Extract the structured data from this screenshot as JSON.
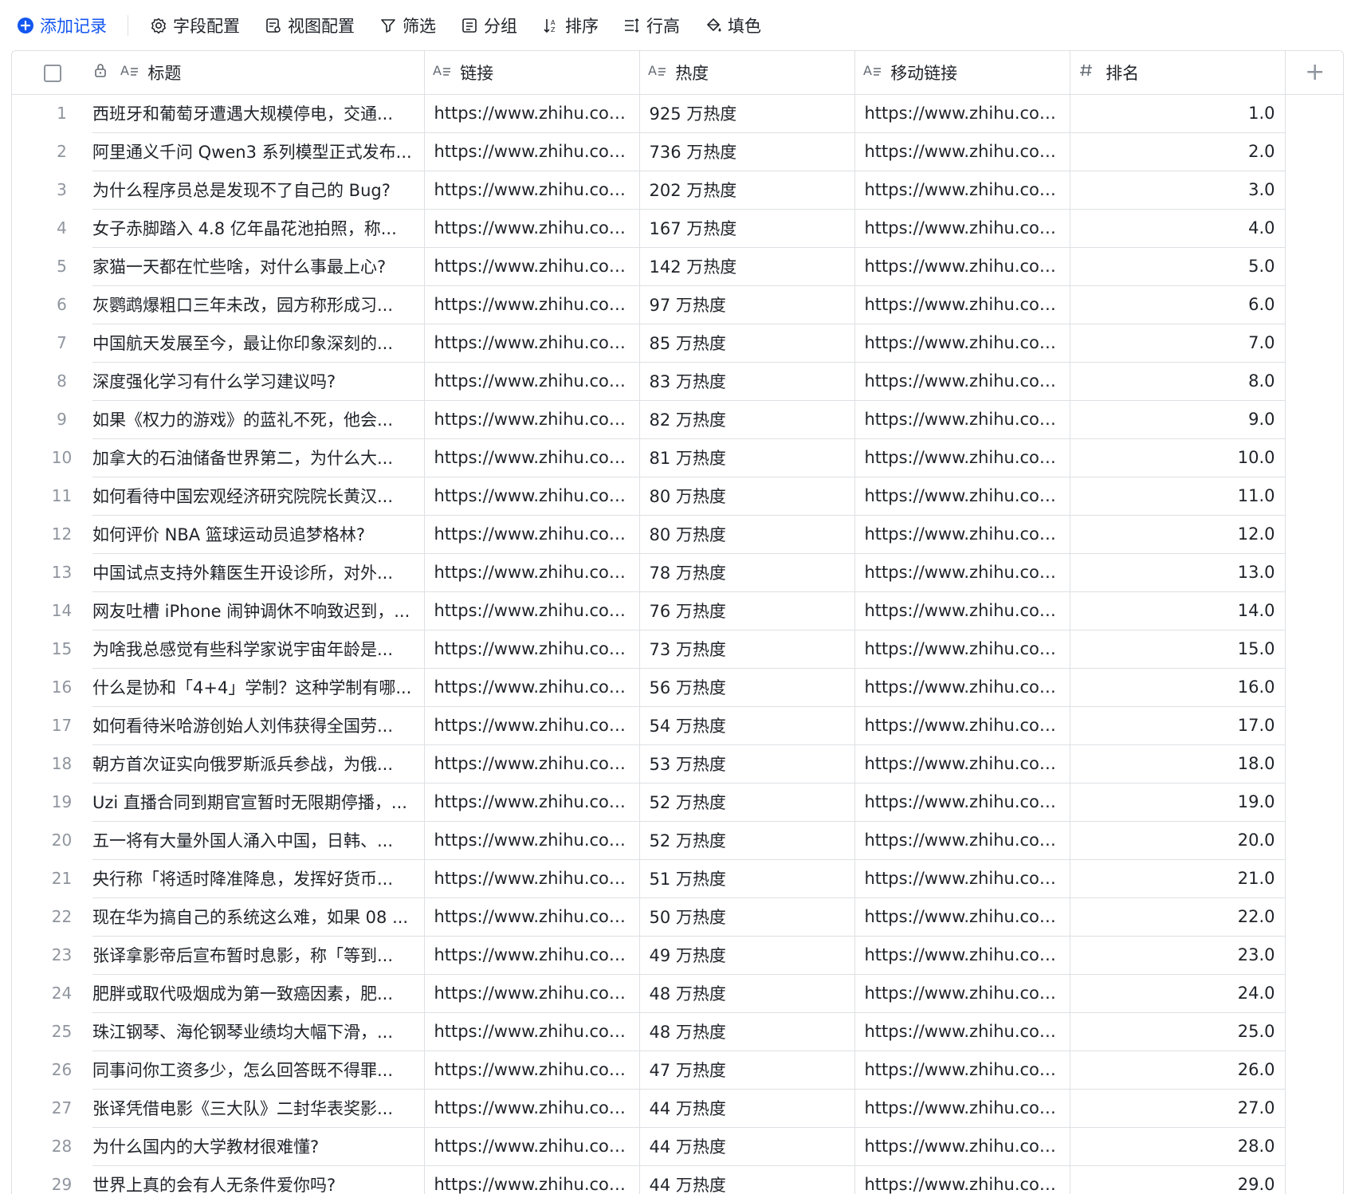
{
  "toolbar": {
    "add_record": "添加记录",
    "field_config": "字段配置",
    "view_config": "视图配置",
    "filter": "筛选",
    "group": "分组",
    "sort": "排序",
    "row_height": "行高",
    "fill_color": "填色"
  },
  "table": {
    "headers": {
      "title": "标题",
      "link": "链接",
      "heat": "热度",
      "mobile_link": "移动链接",
      "rank": "排名",
      "add": "+"
    },
    "rows": [
      {
        "idx": "1",
        "title": "西班牙和葡萄牙遭遇大规模停电，交通...",
        "link": "https://www.zhihu.com/...",
        "heat": "925 万热度",
        "mobile": "https://www.zhihu.com/...",
        "rank": "1.0"
      },
      {
        "idx": "2",
        "title": "阿里通义千问 Qwen3 系列模型正式发布...",
        "link": "https://www.zhihu.com/...",
        "heat": "736 万热度",
        "mobile": "https://www.zhihu.com/...",
        "rank": "2.0"
      },
      {
        "idx": "3",
        "title": "为什么程序员总是发现不了自己的 Bug?",
        "link": "https://www.zhihu.com/...",
        "heat": "202 万热度",
        "mobile": "https://www.zhihu.com/...",
        "rank": "3.0"
      },
      {
        "idx": "4",
        "title": "女子赤脚踏入 4.8 亿年晶花池拍照，称...",
        "link": "https://www.zhihu.com/...",
        "heat": "167 万热度",
        "mobile": "https://www.zhihu.com/...",
        "rank": "4.0"
      },
      {
        "idx": "5",
        "title": "家猫一天都在忙些啥，对什么事最上心?",
        "link": "https://www.zhihu.com/...",
        "heat": "142 万热度",
        "mobile": "https://www.zhihu.com/...",
        "rank": "5.0"
      },
      {
        "idx": "6",
        "title": "灰鹦鹉爆粗口三年未改，园方称形成习...",
        "link": "https://www.zhihu.com/...",
        "heat": "97 万热度",
        "mobile": "https://www.zhihu.com/...",
        "rank": "6.0"
      },
      {
        "idx": "7",
        "title": "中国航天发展至今，最让你印象深刻的...",
        "link": "https://www.zhihu.com/...",
        "heat": "85 万热度",
        "mobile": "https://www.zhihu.com/...",
        "rank": "7.0"
      },
      {
        "idx": "8",
        "title": "深度强化学习有什么学习建议吗?",
        "link": "https://www.zhihu.com/...",
        "heat": "83 万热度",
        "mobile": "https://www.zhihu.com/...",
        "rank": "8.0"
      },
      {
        "idx": "9",
        "title": "如果《权力的游戏》的蓝礼不死，他会...",
        "link": "https://www.zhihu.com/...",
        "heat": "82 万热度",
        "mobile": "https://www.zhihu.com/...",
        "rank": "9.0"
      },
      {
        "idx": "10",
        "title": "加拿大的石油储备世界第二，为什么大...",
        "link": "https://www.zhihu.com/...",
        "heat": "81 万热度",
        "mobile": "https://www.zhihu.com/...",
        "rank": "10.0"
      },
      {
        "idx": "11",
        "title": "如何看待中国宏观经济研究院院长黄汉...",
        "link": "https://www.zhihu.com/...",
        "heat": "80 万热度",
        "mobile": "https://www.zhihu.com/...",
        "rank": "11.0"
      },
      {
        "idx": "12",
        "title": "如何评价 NBA 篮球运动员追梦格林?",
        "link": "https://www.zhihu.com/...",
        "heat": "80 万热度",
        "mobile": "https://www.zhihu.com/...",
        "rank": "12.0"
      },
      {
        "idx": "13",
        "title": "中国试点支持外籍医生开设诊所，对外...",
        "link": "https://www.zhihu.com/...",
        "heat": "78 万热度",
        "mobile": "https://www.zhihu.com/...",
        "rank": "13.0"
      },
      {
        "idx": "14",
        "title": "网友吐槽 iPhone 闹钟调休不响致迟到，...",
        "link": "https://www.zhihu.com/...",
        "heat": "76 万热度",
        "mobile": "https://www.zhihu.com/...",
        "rank": "14.0"
      },
      {
        "idx": "15",
        "title": "为啥我总感觉有些科学家说宇宙年龄是...",
        "link": "https://www.zhihu.com/...",
        "heat": "73 万热度",
        "mobile": "https://www.zhihu.com/...",
        "rank": "15.0"
      },
      {
        "idx": "16",
        "title": "什么是协和「4+4」学制？这种学制有哪...",
        "link": "https://www.zhihu.com/...",
        "heat": "56 万热度",
        "mobile": "https://www.zhihu.com/...",
        "rank": "16.0"
      },
      {
        "idx": "17",
        "title": "如何看待米哈游创始人刘伟获得全国劳...",
        "link": "https://www.zhihu.com/...",
        "heat": "54 万热度",
        "mobile": "https://www.zhihu.com/...",
        "rank": "17.0"
      },
      {
        "idx": "18",
        "title": "朝方首次证实向俄罗斯派兵参战，为俄...",
        "link": "https://www.zhihu.com/...",
        "heat": "53 万热度",
        "mobile": "https://www.zhihu.com/...",
        "rank": "18.0"
      },
      {
        "idx": "19",
        "title": "Uzi 直播合同到期官宣暂时无限期停播，...",
        "link": "https://www.zhihu.com/...",
        "heat": "52 万热度",
        "mobile": "https://www.zhihu.com/...",
        "rank": "19.0"
      },
      {
        "idx": "20",
        "title": "五一将有大量外国人涌入中国，日韩、...",
        "link": "https://www.zhihu.com/...",
        "heat": "52 万热度",
        "mobile": "https://www.zhihu.com/...",
        "rank": "20.0"
      },
      {
        "idx": "21",
        "title": "央行称「将适时降准降息，发挥好货币...",
        "link": "https://www.zhihu.com/...",
        "heat": "51 万热度",
        "mobile": "https://www.zhihu.com/...",
        "rank": "21.0"
      },
      {
        "idx": "22",
        "title": "现在华为搞自己的系统这么难，如果 08 ...",
        "link": "https://www.zhihu.com/...",
        "heat": "50 万热度",
        "mobile": "https://www.zhihu.com/...",
        "rank": "22.0"
      },
      {
        "idx": "23",
        "title": "张译拿影帝后宣布暂时息影，称「等到...",
        "link": "https://www.zhihu.com/...",
        "heat": "49 万热度",
        "mobile": "https://www.zhihu.com/...",
        "rank": "23.0"
      },
      {
        "idx": "24",
        "title": "肥胖或取代吸烟成为第一致癌因素，肥...",
        "link": "https://www.zhihu.com/...",
        "heat": "48 万热度",
        "mobile": "https://www.zhihu.com/...",
        "rank": "24.0"
      },
      {
        "idx": "25",
        "title": "珠江钢琴、海伦钢琴业绩均大幅下滑，...",
        "link": "https://www.zhihu.com/...",
        "heat": "48 万热度",
        "mobile": "https://www.zhihu.com/...",
        "rank": "25.0"
      },
      {
        "idx": "26",
        "title": "同事问你工资多少，怎么回答既不得罪...",
        "link": "https://www.zhihu.com/...",
        "heat": "47 万热度",
        "mobile": "https://www.zhihu.com/...",
        "rank": "26.0"
      },
      {
        "idx": "27",
        "title": "张译凭借电影《三大队》二封华表奖影...",
        "link": "https://www.zhihu.com/...",
        "heat": "44 万热度",
        "mobile": "https://www.zhihu.com/...",
        "rank": "27.0"
      },
      {
        "idx": "28",
        "title": "为什么国内的大学教材很难懂?",
        "link": "https://www.zhihu.com/...",
        "heat": "44 万热度",
        "mobile": "https://www.zhihu.com/...",
        "rank": "28.0"
      },
      {
        "idx": "29",
        "title": "世界上真的会有人无条件爱你吗?",
        "link": "https://www.zhihu.com/...",
        "heat": "44 万热度",
        "mobile": "https://www.zhihu.com/...",
        "rank": "29.0"
      }
    ]
  },
  "colors": {
    "accent": "#1456f0",
    "border": "#dee0e3",
    "muted": "#8f959e"
  }
}
